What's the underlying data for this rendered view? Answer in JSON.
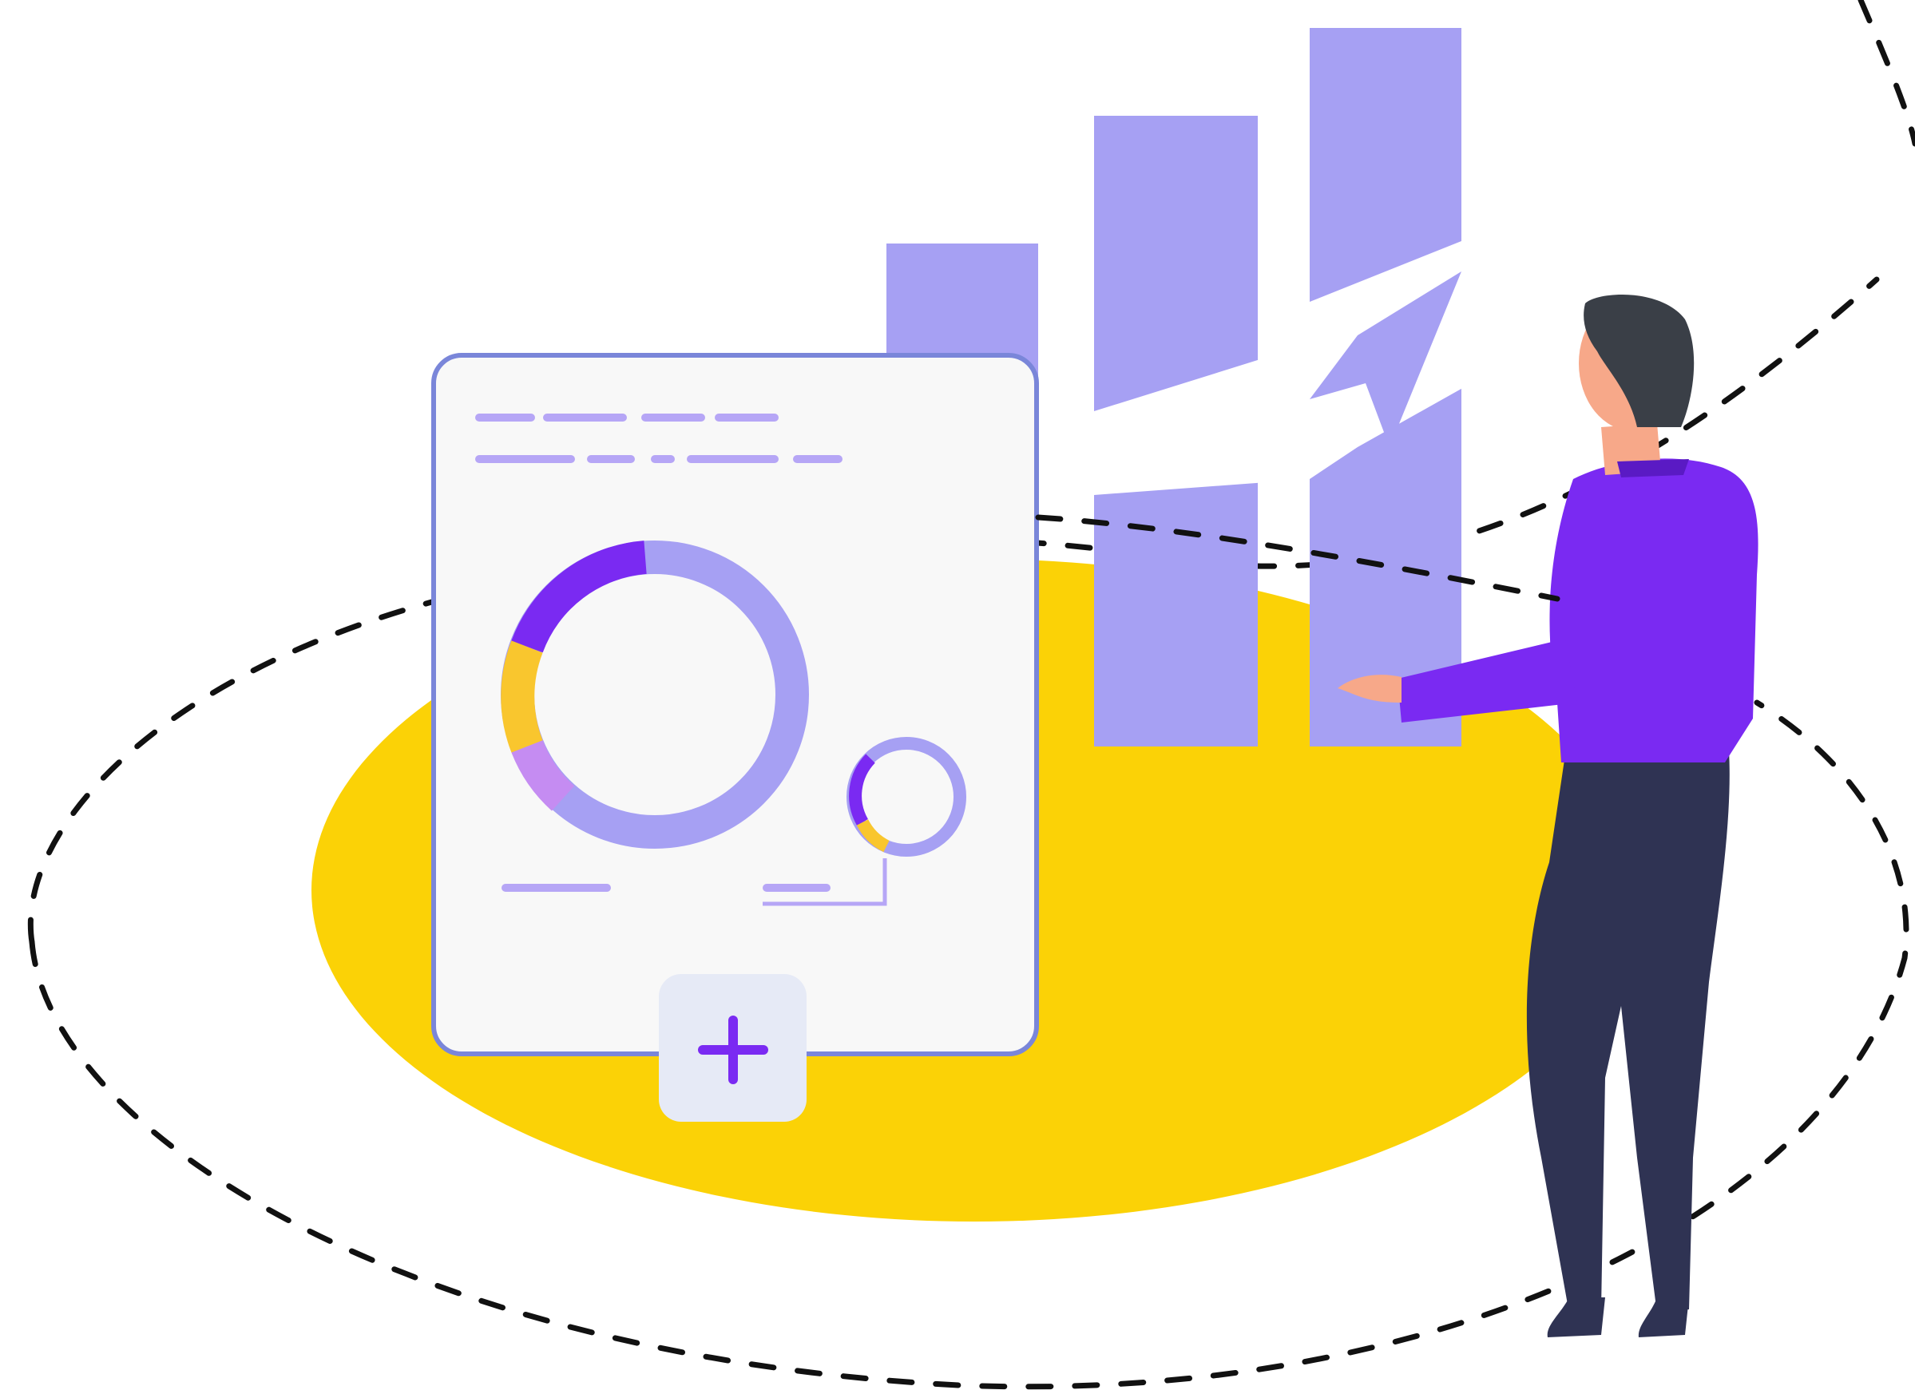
{
  "illustration": {
    "subject": "analytics-dashboard-illustration",
    "colors": {
      "ellipse_fill": "#FBD206",
      "orbit_stroke": "#111111",
      "bar_fill": "#A6A0F3",
      "card_border": "#7A86D9",
      "card_fill": "#F8F8F8",
      "accent_purple": "#7A2AF2",
      "accent_yellow": "#F9C62E",
      "accent_lilac": "#C58CF2",
      "shirt": "#7A2AF2",
      "pants": "#2F3353",
      "hair": "#3A3F47",
      "skin": "#F7A889",
      "add_button_bg": "#E6EAF6"
    },
    "icons": {
      "add_button": "plus-icon",
      "trend": "trend-arrow-icon"
    }
  }
}
